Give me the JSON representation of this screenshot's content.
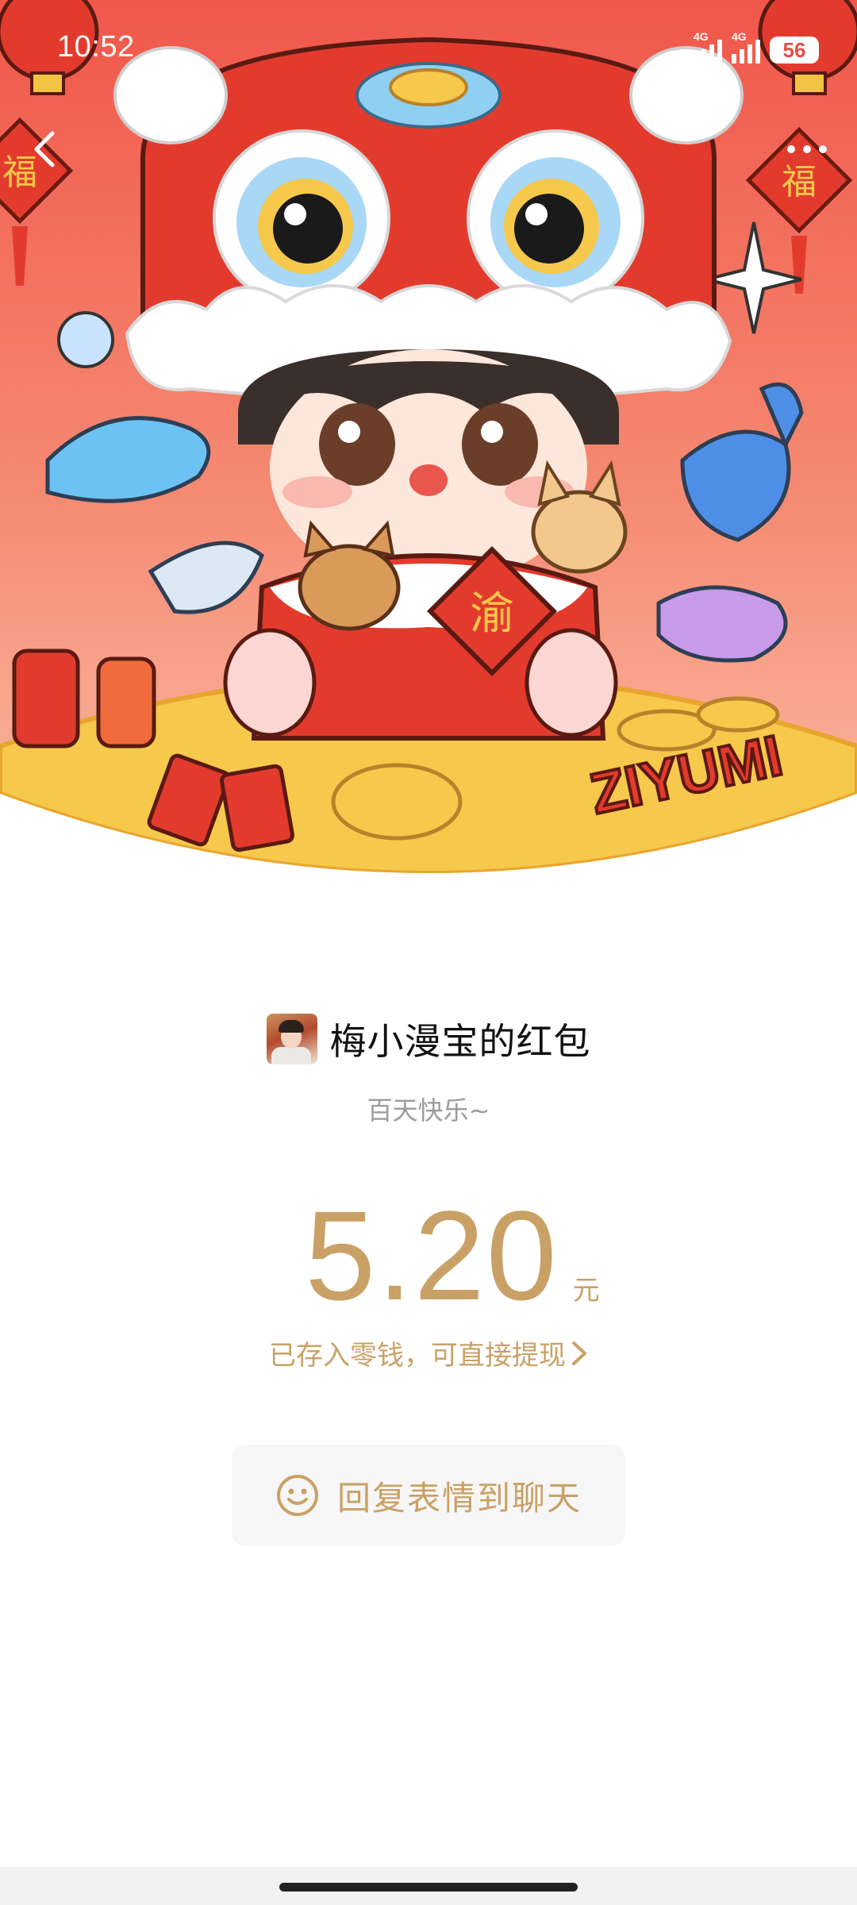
{
  "status_bar": {
    "time": "10:52",
    "network_1": "4G",
    "network_2": "4G",
    "battery": "56"
  },
  "banner": {
    "illustration": "lion-dance-chibi-new-year-illustration",
    "card_character": "渝",
    "fu_character": "福",
    "watermark": "ZIYUMI",
    "colors": {
      "background": "#f0654f",
      "gold_ground": "#f6c84c"
    }
  },
  "nav": {
    "back_icon": "chevron-left-icon",
    "more_icon": "more-dots-icon"
  },
  "sender": {
    "title": "梅小漫宝的红包"
  },
  "greeting": "百天快乐~",
  "amount": {
    "value": "5.20",
    "currency": "元"
  },
  "stored_notice": "已存入零钱，可直接提现",
  "reply_button": {
    "label": "回复表情到聊天",
    "icon": "smile-icon"
  },
  "colors": {
    "accent_gold": "#c9a166",
    "button_bg": "#f6f6f6"
  }
}
